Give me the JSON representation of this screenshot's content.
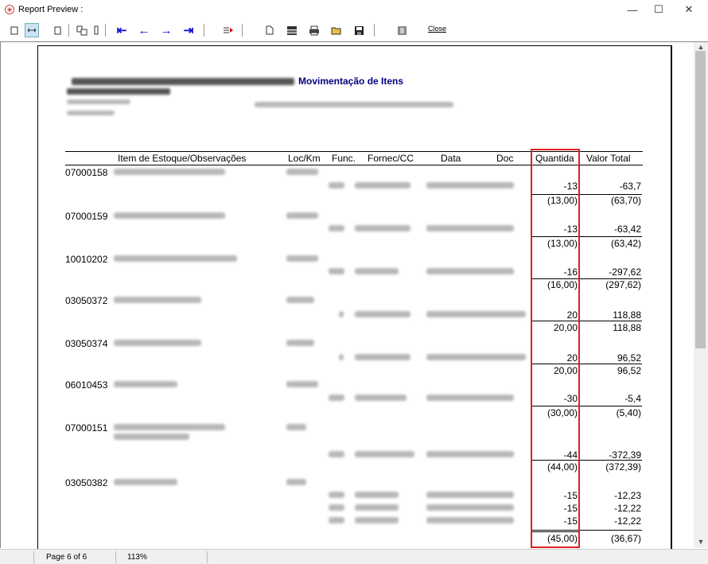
{
  "window": {
    "title": "Report Preview :",
    "minimize": "—",
    "maximize": "☐",
    "close": "✕"
  },
  "toolbar": {
    "close_label": "Close"
  },
  "report": {
    "title": "Movimentação de Itens",
    "columns": [
      "Item de Estoque/Observações",
      "Loc/Km",
      "Func.",
      "Fornec/CC",
      "Data",
      "Doc",
      "Quantida",
      "Valor Total"
    ],
    "items": [
      {
        "code": "07000158",
        "qty": "-13",
        "val": "-63,7",
        "tqty": "(13,00)",
        "tval": "(63,70)"
      },
      {
        "code": "07000159",
        "qty": "-13",
        "val": "-63,42",
        "tqty": "(13,00)",
        "tval": "(63,42)"
      },
      {
        "code": "10010202",
        "qty": "-16",
        "val": "-297,62",
        "tqty": "(16,00)",
        "tval": "(297,62)"
      },
      {
        "code": "03050372",
        "qty": "20",
        "val": "118,88",
        "tqty": "20,00",
        "tval": "118,88"
      },
      {
        "code": "03050374",
        "qty": "20",
        "val": "96,52",
        "tqty": "20,00",
        "tval": "96,52"
      },
      {
        "code": "06010453",
        "qty": "-30",
        "val": "-5,4",
        "tqty": "(30,00)",
        "tval": "(5,40)"
      },
      {
        "code": "07000151",
        "qty": "-44",
        "val": "-372,39",
        "tqty": "(44,00)",
        "tval": "(372,39)"
      },
      {
        "code": "03050382",
        "rows": [
          {
            "qty": "-15",
            "val": "-12,23"
          },
          {
            "qty": "-15",
            "val": "-12,22"
          },
          {
            "qty": "-15",
            "val": "-12,22"
          }
        ],
        "tqty": "(45,00)",
        "tval": "(36,67)"
      }
    ]
  },
  "status": {
    "page": "Page 6 of 6",
    "zoom": "113%"
  }
}
